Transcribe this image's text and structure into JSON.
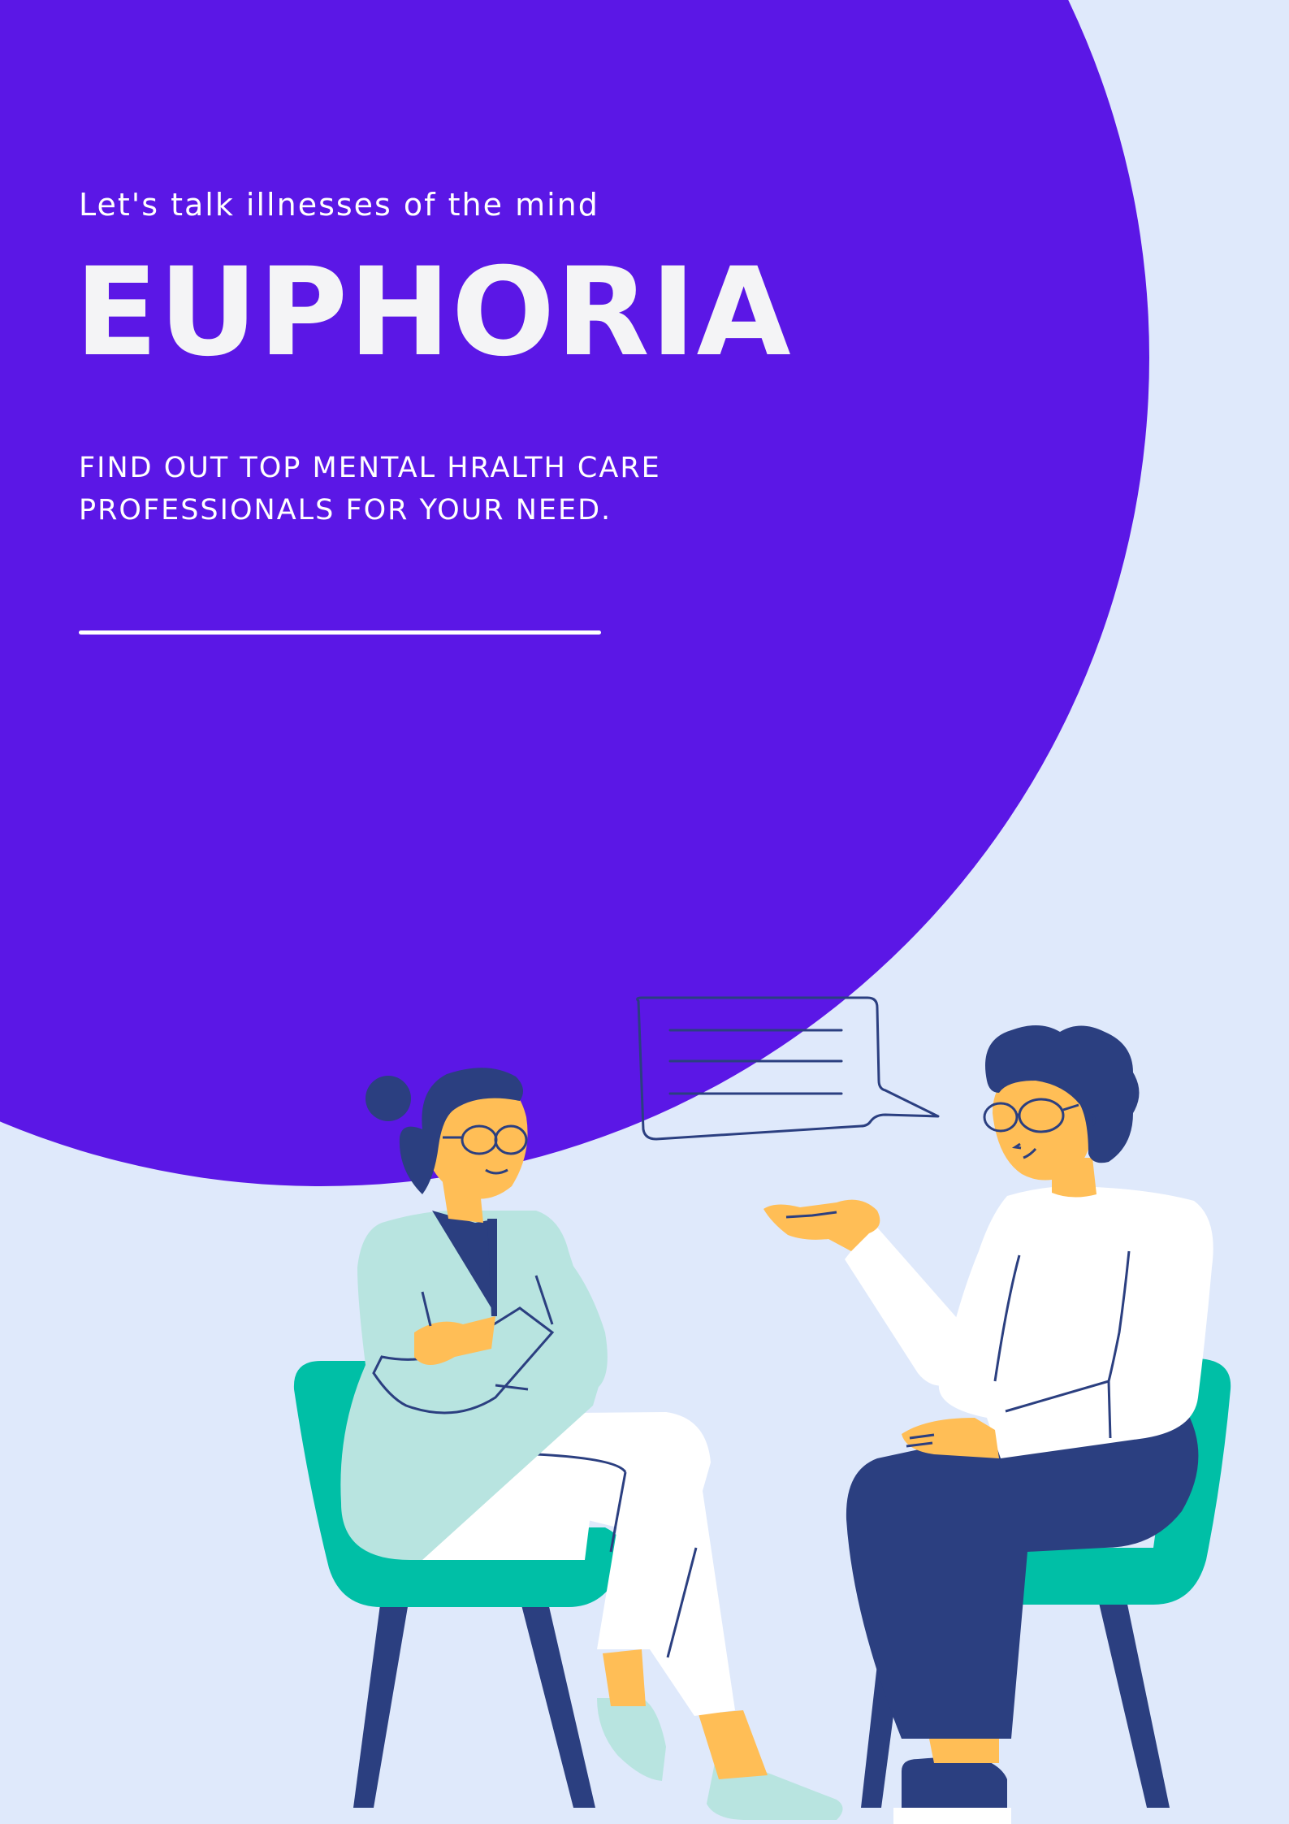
{
  "poster": {
    "tagline": "Let's talk illnesses of the mind",
    "title": "EUPHORIA",
    "subtitle": "FIND OUT TOP MENTAL HRALTH CARE PROFESSIONALS FOR YOUR NEED."
  },
  "colors": {
    "background": "#dfe9fb",
    "circle": "#5b17e6",
    "text": "#ffffff",
    "navy": "#2b3f80",
    "chair": "#00bfa6",
    "skin": "#ffbe56",
    "coat": "#b8e4e0",
    "shirt": "#ffffff"
  },
  "illustration": {
    "icons": [
      "speech-bubble-icon",
      "therapist-figure",
      "patient-figure",
      "chair-left",
      "chair-right"
    ]
  }
}
